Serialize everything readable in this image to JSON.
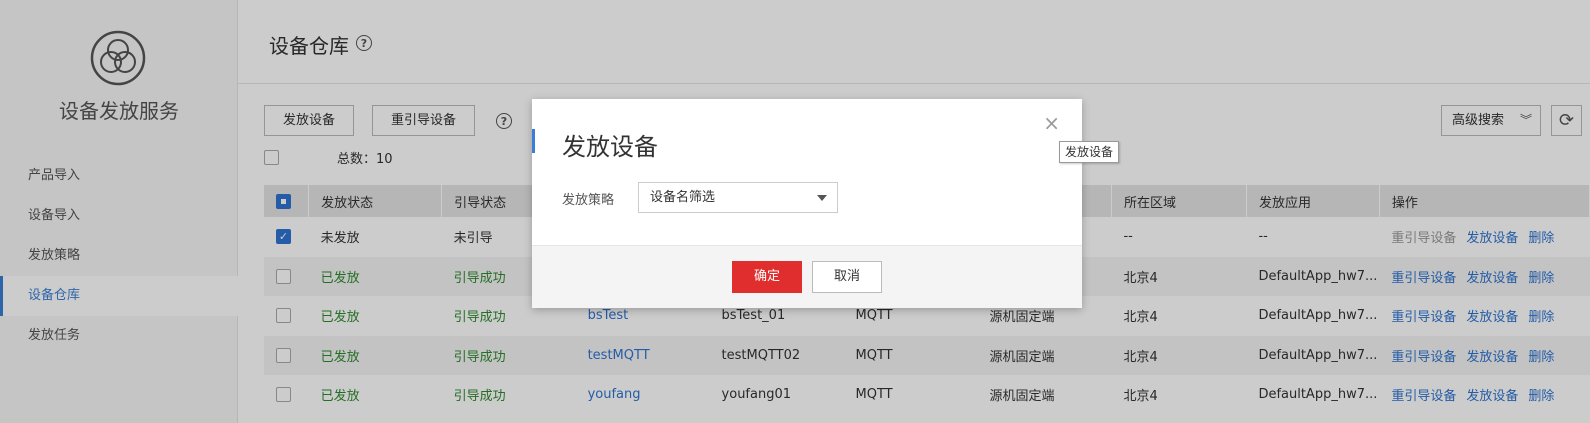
{
  "sidebar": {
    "title": "设备发放服务",
    "items": [
      {
        "label": "产品导入"
      },
      {
        "label": "设备导入"
      },
      {
        "label": "发放策略"
      },
      {
        "label": "设备仓库"
      },
      {
        "label": "发放任务"
      }
    ]
  },
  "header": {
    "title": "设备仓库",
    "help": "?"
  },
  "toolbar": {
    "provision_label": "发放设备",
    "reboot_label": "重引导设备",
    "help": "?",
    "advanced_search_label": "高级搜索",
    "refresh_icon": "refresh-icon"
  },
  "total": {
    "text": "总数：10"
  },
  "table": {
    "columns": [
      "发放状态",
      "引导状态",
      "",
      "",
      "",
      "",
      "所在区域",
      "发放应用",
      "操作"
    ],
    "rows": [
      {
        "checked": true,
        "status": "未发放",
        "boot": "未引导",
        "name": "",
        "id": "",
        "protocol": "",
        "type": "",
        "region": "--",
        "app": "--",
        "ops": [
          "重引导设备",
          "发放设备",
          "删除"
        ]
      },
      {
        "checked": false,
        "status": "已发放",
        "boot": "引导成功",
        "name": "",
        "id": "",
        "protocol": "",
        "type": "",
        "region": "北京4",
        "app": "DefaultApp_hw7...",
        "ops": [
          "重引导设备",
          "发放设备",
          "删除"
        ]
      },
      {
        "checked": false,
        "status": "已发放",
        "boot": "引导成功",
        "name": "bsTest",
        "id": "bsTest_01",
        "protocol": "MQTT",
        "type": "源机固定端",
        "region": "北京4",
        "app": "DefaultApp_hw7...",
        "ops": [
          "重引导设备",
          "发放设备",
          "删除"
        ]
      },
      {
        "checked": false,
        "status": "已发放",
        "boot": "引导成功",
        "name": "testMQTT",
        "id": "testMQTT02",
        "protocol": "MQTT",
        "type": "源机固定端",
        "region": "北京4",
        "app": "DefaultApp_hw7...",
        "ops": [
          "重引导设备",
          "发放设备",
          "删除"
        ]
      },
      {
        "checked": false,
        "status": "已发放",
        "boot": "引导成功",
        "name": "youfang",
        "id": "youfang01",
        "protocol": "MQTT",
        "type": "源机固定端",
        "region": "北京4",
        "app": "DefaultApp_hw7...",
        "ops": [
          "重引导设备",
          "发放设备",
          "删除"
        ]
      }
    ]
  },
  "modal": {
    "title": "发放设备",
    "close": "×",
    "strategy_label": "发放策略",
    "strategy_value": "设备名筛选",
    "ok_label": "确定",
    "cancel_label": "取消"
  },
  "tooltip": {
    "text": "发放设备"
  },
  "colors": {
    "accent": "#2e74d1",
    "danger": "#e02e2e",
    "success": "#2f8a2f"
  }
}
